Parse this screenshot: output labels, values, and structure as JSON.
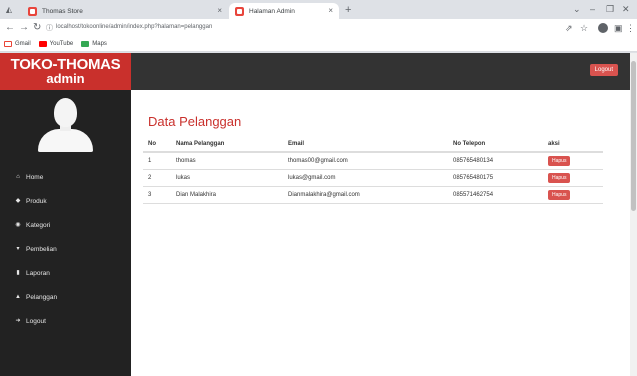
{
  "browser": {
    "tabs": [
      {
        "title": "Thomas Store",
        "active": false
      },
      {
        "title": "Halaman Admin",
        "active": true
      }
    ],
    "new_tab": "+",
    "url": "localhost/tokoonline/admin/index.php?halaman=pelanggan",
    "bookmarks": [
      {
        "label": "Gmail",
        "icon": "gmail-icon"
      },
      {
        "label": "YouTube",
        "icon": "youtube-icon"
      },
      {
        "label": "Maps",
        "icon": "maps-icon"
      }
    ]
  },
  "brand": {
    "line1": "TOKO-THOMAS",
    "line2": "admin"
  },
  "topnav": {
    "logout_label": "Logout"
  },
  "sidebar": {
    "items": [
      {
        "label": "Home",
        "icon": "home-icon"
      },
      {
        "label": "Produk",
        "icon": "product-icon"
      },
      {
        "label": "Kategori",
        "icon": "tag-icon"
      },
      {
        "label": "Pembelian",
        "icon": "cart-icon"
      },
      {
        "label": "Laporan",
        "icon": "report-icon"
      },
      {
        "label": "Pelanggan",
        "icon": "user-icon"
      },
      {
        "label": "Logout",
        "icon": "logout-icon"
      }
    ]
  },
  "main": {
    "title": "Data Pelanggan",
    "columns": [
      "No",
      "Nama Pelanggan",
      "Email",
      "No Telepon",
      "aksi"
    ],
    "rows": [
      {
        "no": "1",
        "nama": "thomas",
        "email": "thomas00@gmail.com",
        "telepon": "085765480134",
        "aksi": "Hapus"
      },
      {
        "no": "2",
        "nama": "lukas",
        "email": "lukas@gmail.com",
        "telepon": "085765480175",
        "aksi": "Hapus"
      },
      {
        "no": "3",
        "nama": "Dian Malakhira",
        "email": "Dianmalakhira@gmail.com",
        "telepon": "085571462754",
        "aksi": "Hapus"
      }
    ]
  },
  "colors": {
    "brand_red": "#c9302c",
    "button_red": "#d9534f",
    "sidebar_bg": "#222222",
    "topbar_bg": "#333333"
  }
}
